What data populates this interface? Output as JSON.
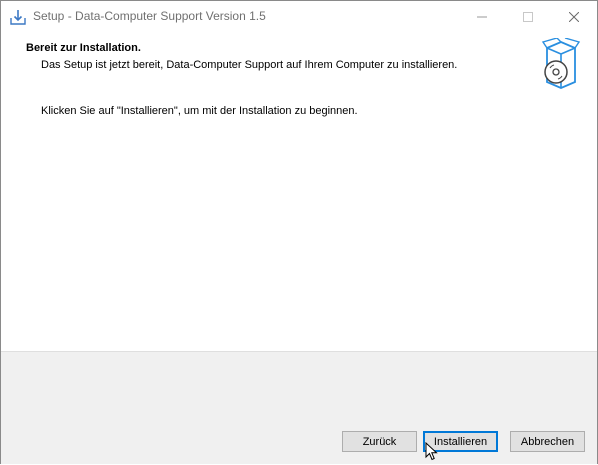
{
  "window": {
    "title": "Setup - Data-Computer Support Version 1.5",
    "icon": "setup-download-icon",
    "controls": [
      "minimize-icon",
      "maximize-icon",
      "close-icon"
    ]
  },
  "header": {
    "title": "Bereit zur Installation.",
    "subtitle": "Das Setup ist jetzt bereit, Data-Computer Support auf Ihrem Computer zu installieren.",
    "graphic": "box-disc-icon"
  },
  "content": {
    "instruction": "Klicken Sie auf \"Installieren\", um mit der Installation zu beginnen."
  },
  "buttons": {
    "back": "Zurück",
    "install": "Installieren",
    "cancel": "Abbrechen"
  },
  "colors": {
    "accent": "#0078d7",
    "footer": "#f0f0f0"
  }
}
